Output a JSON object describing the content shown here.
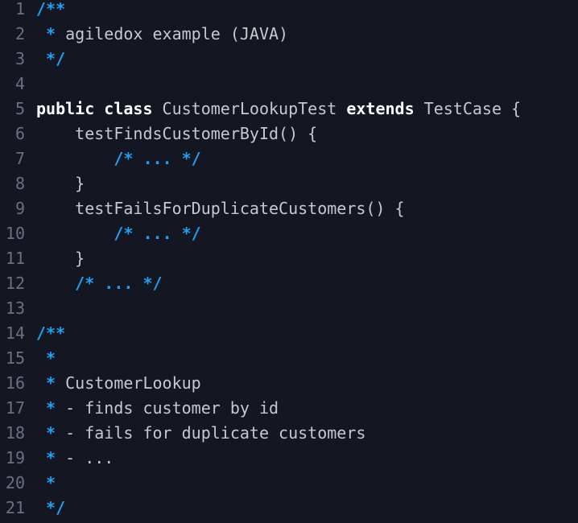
{
  "colors": {
    "background": "#141722",
    "line_number": "#6b7080",
    "comment": "#1da1f2",
    "keyword": "#ffffff",
    "text": "#c8c8cc"
  },
  "lines": [
    {
      "n": "1",
      "tokens": [
        {
          "t": "/**",
          "c": "comment-marker"
        }
      ]
    },
    {
      "n": "2",
      "tokens": [
        {
          "t": " *",
          "c": "comment-marker"
        },
        {
          "t": " agiledox example (JAVA)",
          "c": "comment-text"
        }
      ]
    },
    {
      "n": "3",
      "tokens": [
        {
          "t": " */",
          "c": "comment-marker"
        }
      ]
    },
    {
      "n": "4",
      "tokens": []
    },
    {
      "n": "5",
      "tokens": [
        {
          "t": "public",
          "c": "keyword"
        },
        {
          "t": " ",
          "c": "ident"
        },
        {
          "t": "class",
          "c": "keyword"
        },
        {
          "t": " CustomerLookupTest ",
          "c": "ident"
        },
        {
          "t": "extends",
          "c": "keyword"
        },
        {
          "t": " TestCase {",
          "c": "ident"
        }
      ]
    },
    {
      "n": "6",
      "tokens": [
        {
          "t": "    testFindsCustomerById() {",
          "c": "ident"
        }
      ]
    },
    {
      "n": "7",
      "tokens": [
        {
          "t": "        ",
          "c": "ident"
        },
        {
          "t": "/* ... */",
          "c": "comment-marker"
        }
      ]
    },
    {
      "n": "8",
      "tokens": [
        {
          "t": "    }",
          "c": "ident"
        }
      ]
    },
    {
      "n": "9",
      "tokens": [
        {
          "t": "    testFailsForDuplicateCustomers() {",
          "c": "ident"
        }
      ]
    },
    {
      "n": "10",
      "tokens": [
        {
          "t": "        ",
          "c": "ident"
        },
        {
          "t": "/* ... */",
          "c": "comment-marker"
        }
      ]
    },
    {
      "n": "11",
      "tokens": [
        {
          "t": "    }",
          "c": "ident"
        }
      ]
    },
    {
      "n": "12",
      "tokens": [
        {
          "t": "    ",
          "c": "ident"
        },
        {
          "t": "/* ... */",
          "c": "comment-marker"
        }
      ]
    },
    {
      "n": "13",
      "tokens": []
    },
    {
      "n": "14",
      "tokens": [
        {
          "t": "/**",
          "c": "comment-marker"
        }
      ]
    },
    {
      "n": "15",
      "tokens": [
        {
          "t": " *",
          "c": "comment-marker"
        }
      ]
    },
    {
      "n": "16",
      "tokens": [
        {
          "t": " *",
          "c": "comment-marker"
        },
        {
          "t": " CustomerLookup",
          "c": "comment-text"
        }
      ]
    },
    {
      "n": "17",
      "tokens": [
        {
          "t": " *",
          "c": "comment-marker"
        },
        {
          "t": " - finds customer by id",
          "c": "comment-text"
        }
      ]
    },
    {
      "n": "18",
      "tokens": [
        {
          "t": " *",
          "c": "comment-marker"
        },
        {
          "t": " - fails for duplicate customers",
          "c": "comment-text"
        }
      ]
    },
    {
      "n": "19",
      "tokens": [
        {
          "t": " *",
          "c": "comment-marker"
        },
        {
          "t": " - ...",
          "c": "comment-text"
        }
      ]
    },
    {
      "n": "20",
      "tokens": [
        {
          "t": " *",
          "c": "comment-marker"
        }
      ]
    },
    {
      "n": "21",
      "tokens": [
        {
          "t": " */",
          "c": "comment-marker"
        }
      ]
    }
  ]
}
